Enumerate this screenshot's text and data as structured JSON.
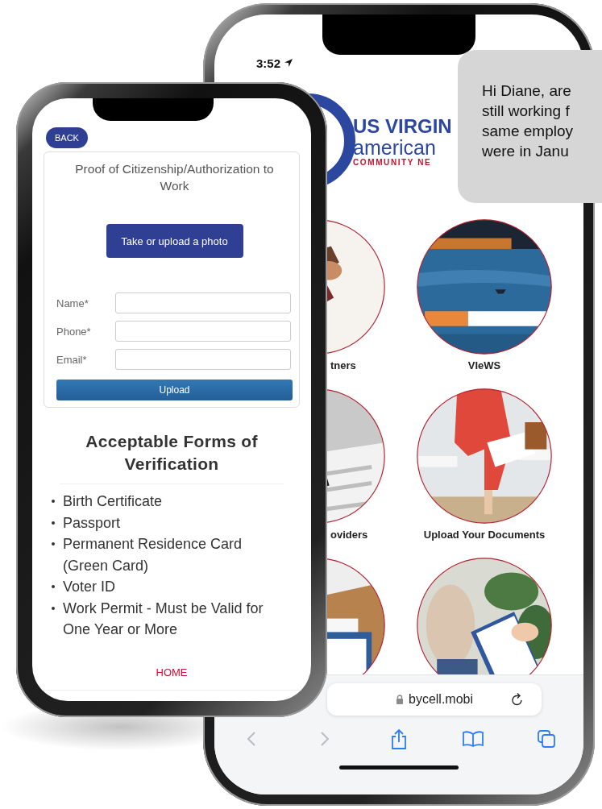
{
  "back_phone": {
    "status_bar": {
      "time": "3:52"
    },
    "logo": {
      "line_1": "US VIRGIN",
      "line_2": "american",
      "line_3": "COMMUNITY NE"
    },
    "message_bubble": {
      "lines": [
        "Hi Diane, are",
        "still working f",
        "same employ",
        "were in Janu"
      ]
    },
    "tiles": [
      {
        "kind": "picture",
        "label": "tners"
      },
      {
        "kind": "picture",
        "label": "VIeWS"
      },
      {
        "kind": "picture",
        "label": "oviders"
      },
      {
        "kind": "picture",
        "label": "Upload Your Documents"
      },
      {
        "kind": "picture"
      },
      {
        "kind": "picture"
      }
    ],
    "address_bar": {
      "url": "bycell.mobi"
    }
  },
  "front_phone": {
    "back_button": "BACK",
    "card": {
      "title": "Proof of Citizenship/Authorization to Work",
      "photo_button": "Take or upload a photo",
      "fields": [
        {
          "label": "Name*"
        },
        {
          "label": "Phone*"
        },
        {
          "label": "Email*"
        }
      ],
      "upload_button": "Upload"
    },
    "section_title": "Acceptable Forms of Verification",
    "documents": [
      "Birth Certificate",
      "Passport",
      "Permanent Residence Card (Green Card)",
      "Voter ID",
      "Work Permit - Must be Valid for One Year or More"
    ],
    "home_link": "HOME"
  }
}
